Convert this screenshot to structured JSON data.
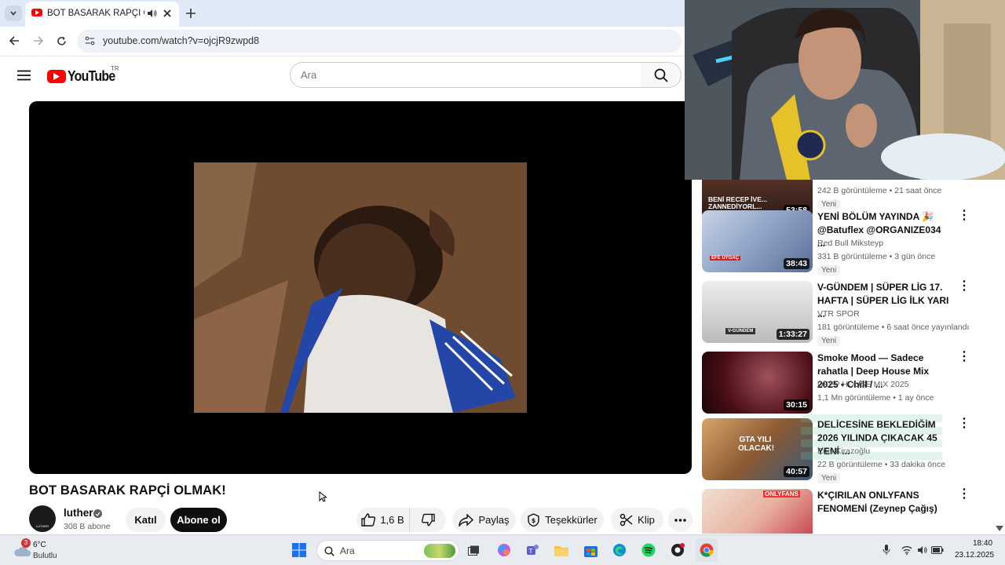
{
  "browser": {
    "tab_title": "BOT BASARAK RAPÇİ OLMA",
    "url": "youtube.com/watch?v=ojcjR9zwpd8"
  },
  "youtube": {
    "logo_text": "YouTube",
    "region": "TR",
    "search_placeholder": "Ara"
  },
  "video": {
    "title": "BOT BASARAK RAPÇİ OLMAK!",
    "channel": "luther",
    "subscribers": "308 B abone",
    "join_label": "Katıl",
    "subscribe_label": "Abone ol",
    "likes": "1,6 B",
    "share_label": "Paylaş",
    "thanks_label": "Teşekkürler",
    "clip_label": "Klip",
    "avatar_text": "LUTHER"
  },
  "recommendations": [
    {
      "title": "",
      "channel": "",
      "meta": "242 B görüntüleme • 21 saat önce",
      "badge": "Yeni",
      "duration": "53:58",
      "thumb_text": "BENİ RECEP İVE... ZANNEDİYORL..."
    },
    {
      "title": "YENİ BÖLÜM YAYINDA 🎉 @Batuflex @ORGANIZE034 ...",
      "channel": "Red Bull Miksteyp",
      "meta": "331 B görüntüleme • 3 gün önce",
      "badge": "Yeni",
      "duration": "38:43",
      "thumb_text": "EFE UYGAÇ"
    },
    {
      "title": "V-GÜNDEM | SÜPER LİG 17. HAFTA | SÜPER LİG İLK YARI ...",
      "channel": "VTR SPOR",
      "meta": "181 görüntüleme • 6 saat önce yayınlandı",
      "badge": "Yeni",
      "duration": "1:33:27",
      "thumb_text": "V-GÜNDEM"
    },
    {
      "title": "Smoke Mood — Sadece rahatla | Deep House Mix 2025 • Chill / ...",
      "channel": "DEEP HOUSE MIX 2025",
      "meta": "1,1 Mn görüntüleme • 1 ay önce",
      "badge": "",
      "duration": "30:15",
      "thumb_text": ""
    },
    {
      "title": "DELİCESİNE BEKLEDİĞİM 2026 YILINDA ÇIKACAK 45 YENİ ...",
      "channel": "Enis Kirazoğlu",
      "meta": "22 B görüntüleme • 33 dakika önce",
      "badge": "Yeni",
      "duration": "40:57",
      "thumb_text": "GTA YILI OLACAK!"
    },
    {
      "title": "K*ÇIRILAN ONLYFANS FENOMENİ (Zeynep Çağış)",
      "channel": "",
      "meta": "",
      "badge": "",
      "duration": "",
      "thumb_text": "ONLYFANS"
    }
  ],
  "taskbar": {
    "temp": "6°C",
    "weather": "Bulutlu",
    "weather_badge": "3",
    "search_placeholder": "Ara",
    "time": "18:40",
    "date": "23.12.2025"
  }
}
